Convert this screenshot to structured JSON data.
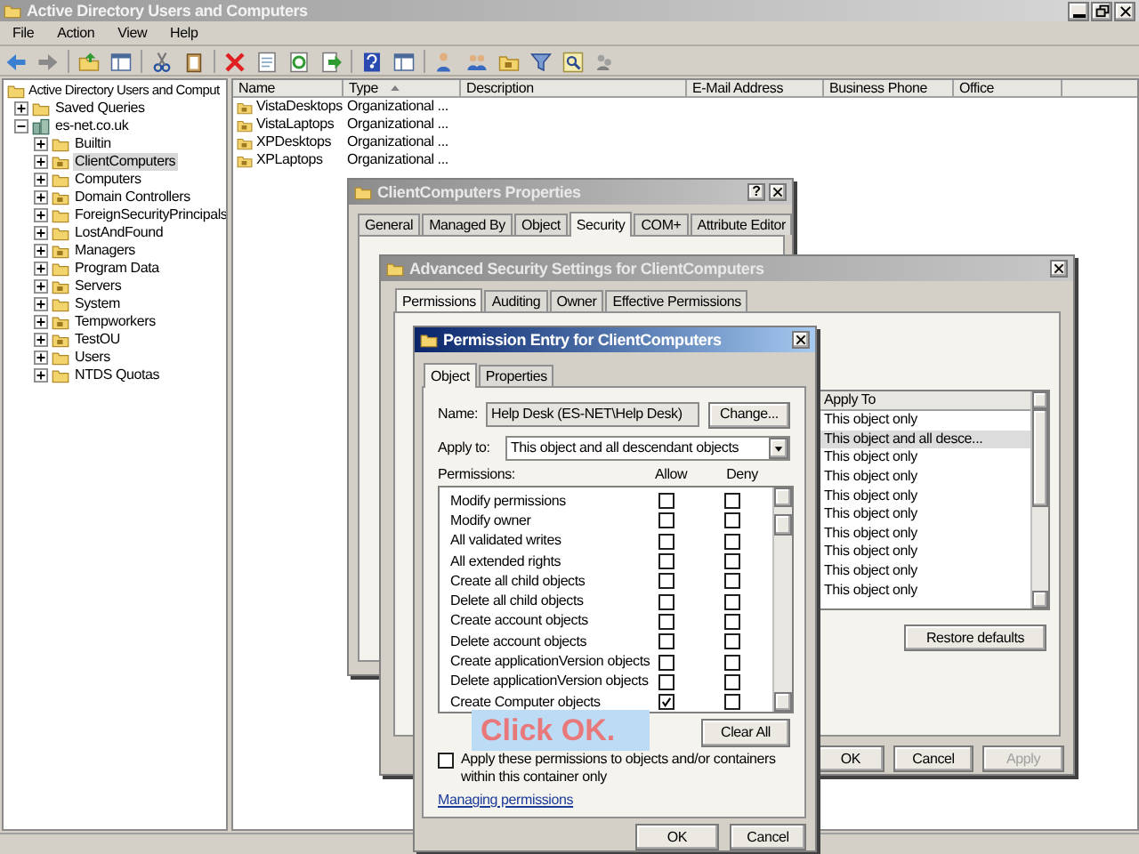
{
  "main_window": {
    "title": "Active Directory Users and Computers",
    "menu": [
      "File",
      "Action",
      "View",
      "Help"
    ],
    "tree": {
      "label": "Active Directory Users and Comput",
      "children": [
        {
          "label": "Saved Queries",
          "kind": "folder",
          "expanded": false,
          "selected": false
        },
        {
          "label": "es-net.co.uk",
          "kind": "domain",
          "expanded": true,
          "selected": false,
          "children": [
            {
              "label": "Builtin",
              "kind": "folder",
              "expanded": false,
              "selected": false
            },
            {
              "label": "ClientComputers",
              "kind": "ou",
              "expanded": false,
              "selected": true
            },
            {
              "label": "Computers",
              "kind": "folder",
              "expanded": false,
              "selected": false
            },
            {
              "label": "Domain Controllers",
              "kind": "ou",
              "expanded": false,
              "selected": false
            },
            {
              "label": "ForeignSecurityPrincipals",
              "kind": "folder",
              "expanded": false,
              "selected": false
            },
            {
              "label": "LostAndFound",
              "kind": "folder",
              "expanded": false,
              "selected": false
            },
            {
              "label": "Managers",
              "kind": "ou",
              "expanded": false,
              "selected": false
            },
            {
              "label": "Program Data",
              "kind": "folder",
              "expanded": false,
              "selected": false
            },
            {
              "label": "Servers",
              "kind": "ou",
              "expanded": false,
              "selected": false
            },
            {
              "label": "System",
              "kind": "folder",
              "expanded": false,
              "selected": false
            },
            {
              "label": "Tempworkers",
              "kind": "ou",
              "expanded": false,
              "selected": false
            },
            {
              "label": "TestOU",
              "kind": "ou",
              "expanded": false,
              "selected": false
            },
            {
              "label": "Users",
              "kind": "folder",
              "expanded": false,
              "selected": false
            },
            {
              "label": "NTDS Quotas",
              "kind": "folder",
              "expanded": false,
              "selected": false
            }
          ]
        }
      ]
    },
    "columns": [
      {
        "label": "Name",
        "sorted": false
      },
      {
        "label": "Type",
        "sorted": true
      },
      {
        "label": "Description",
        "sorted": false
      },
      {
        "label": "E-Mail Address",
        "sorted": false
      },
      {
        "label": "Business Phone",
        "sorted": false
      },
      {
        "label": "Office",
        "sorted": false
      }
    ],
    "rows": [
      {
        "name": "VistaDesktops",
        "type": "Organizational ..."
      },
      {
        "name": "VistaLaptops",
        "type": "Organizational ..."
      },
      {
        "name": "XPDesktops",
        "type": "Organizational ..."
      },
      {
        "name": "XPLaptops",
        "type": "Organizational ..."
      }
    ]
  },
  "properties_dialog": {
    "title": "ClientComputers Properties",
    "help_button": "?",
    "tabs": [
      {
        "label": "General",
        "selected": false
      },
      {
        "label": "Managed By",
        "selected": false
      },
      {
        "label": "Object",
        "selected": false
      },
      {
        "label": "Security",
        "selected": true
      },
      {
        "label": "COM+",
        "selected": false
      },
      {
        "label": "Attribute Editor",
        "selected": false
      }
    ]
  },
  "advanced_dialog": {
    "title": "Advanced Security Settings for ClientComputers",
    "tabs": [
      {
        "label": "Permissions",
        "selected": true
      },
      {
        "label": "Auditing",
        "selected": false
      },
      {
        "label": "Owner",
        "selected": false
      },
      {
        "label": "Effective Permissions",
        "selected": false
      }
    ],
    "column": "Apply To",
    "rows": [
      {
        "apply_to": "This object only",
        "selected": false
      },
      {
        "apply_to": "This object and all desce...",
        "selected": true
      },
      {
        "apply_to": "This object only",
        "selected": false
      },
      {
        "apply_to": "This object only",
        "selected": false
      },
      {
        "apply_to": "This object only",
        "selected": false
      },
      {
        "apply_to": "This object only",
        "selected": false
      },
      {
        "apply_to": "This object only",
        "selected": false
      },
      {
        "apply_to": "This object only",
        "selected": false
      },
      {
        "apply_to": "This object only",
        "selected": false
      },
      {
        "apply_to": "This object only",
        "selected": false
      }
    ],
    "restore_button": "Restore defaults",
    "buttons": [
      {
        "label": "OK",
        "disabled": false
      },
      {
        "label": "Cancel",
        "disabled": false
      },
      {
        "label": "Apply",
        "disabled": true
      }
    ]
  },
  "permission_entry": {
    "title": "Permission Entry for ClientComputers",
    "tabs": [
      {
        "label": "Object",
        "selected": true
      },
      {
        "label": "Properties",
        "selected": false
      }
    ],
    "name_label": "Name:",
    "name_value": "Help Desk (ES-NET\\Help Desk)",
    "change_button": "Change...",
    "apply_label": "Apply to:",
    "apply_value": "This object and all descendant objects",
    "permissions_label": "Permissions:",
    "allow_label": "Allow",
    "deny_label": "Deny",
    "permissions": [
      {
        "name": "Modify permissions",
        "allow": false,
        "deny": false
      },
      {
        "name": "Modify owner",
        "allow": false,
        "deny": false
      },
      {
        "name": "All validated writes",
        "allow": false,
        "deny": false
      },
      {
        "name": "All extended rights",
        "allow": false,
        "deny": false
      },
      {
        "name": "Create all child objects",
        "allow": false,
        "deny": false
      },
      {
        "name": "Delete all child objects",
        "allow": false,
        "deny": false
      },
      {
        "name": "Create account objects",
        "allow": false,
        "deny": false
      },
      {
        "name": "Delete account objects",
        "allow": false,
        "deny": false
      },
      {
        "name": "Create applicationVersion objects",
        "allow": false,
        "deny": false
      },
      {
        "name": "Delete applicationVersion objects",
        "allow": false,
        "deny": false
      },
      {
        "name": "Create Computer objects",
        "allow": true,
        "deny": false
      }
    ],
    "apply_checkbox": {
      "label": "Apply these permissions to objects and/or containers within this container only",
      "checked": false
    },
    "clear_button": "Clear All",
    "link": "Managing permissions",
    "buttons": [
      "OK",
      "Cancel"
    ]
  },
  "callout": {
    "text": "Click OK."
  }
}
